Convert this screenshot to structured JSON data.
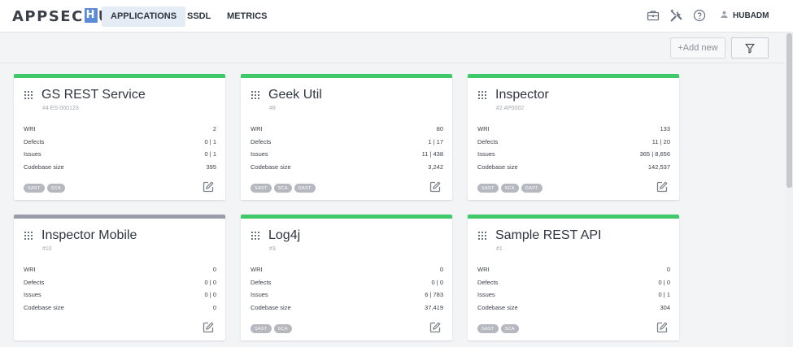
{
  "header": {
    "logo_left": "APPSEC",
    "logo_h": "H",
    "logo_right": "UB",
    "tabs": [
      {
        "label": "APPLICATIONS",
        "active": true
      },
      {
        "label": "SSDL",
        "active": false
      },
      {
        "label": "METRICS",
        "active": false
      }
    ],
    "icons": [
      "briefcase-icon",
      "tools-icon",
      "help-icon"
    ],
    "user": "HUBADM"
  },
  "toolbar": {
    "add_label": "+Add new",
    "filter_icon": "filter-icon"
  },
  "metric_labels": {
    "wri": "WRI",
    "defects": "Defects",
    "issues": "Issues",
    "codebase": "Codebase size"
  },
  "colors": {
    "accent_green": "#3fc96a",
    "accent_gray": "#9a9bab",
    "tab_active_bg": "#e5ecf5"
  },
  "cards": [
    {
      "title": "GS REST Service",
      "sub": "#4 ES-000123",
      "wri": "2",
      "defects": "0 | 1",
      "issues": "0 | 1",
      "codebase": "395",
      "tags": [
        "SAST",
        "SCA"
      ],
      "status": "green"
    },
    {
      "title": "Geek Util",
      "sub": "#8",
      "wri": "80",
      "defects": "1 | 17",
      "issues": "11 | 438",
      "codebase": "3,242",
      "tags": [
        "SAST",
        "SCA",
        "DAST"
      ],
      "status": "green"
    },
    {
      "title": "Inspector",
      "sub": "#2 AP0002",
      "wri": "133",
      "defects": "11 | 20",
      "issues": "365 | 8,656",
      "codebase": "142,537",
      "tags": [
        "SAST",
        "SCA",
        "DAST"
      ],
      "status": "green"
    },
    {
      "title": "Inspector Mobile",
      "sub": "#10",
      "wri": "0",
      "defects": "0 | 0",
      "issues": "0 | 0",
      "codebase": "0",
      "tags": [],
      "status": "gray"
    },
    {
      "title": "Log4j",
      "sub": "#3",
      "wri": "0",
      "defects": "0 | 0",
      "issues": "6 | 783",
      "codebase": "37,419",
      "tags": [
        "SAST",
        "SCA"
      ],
      "status": "green"
    },
    {
      "title": "Sample REST API",
      "sub": "#1",
      "wri": "0",
      "defects": "0 | 0",
      "issues": "0 | 1",
      "codebase": "304",
      "tags": [
        "SAST",
        "SCA"
      ],
      "status": "green"
    }
  ]
}
